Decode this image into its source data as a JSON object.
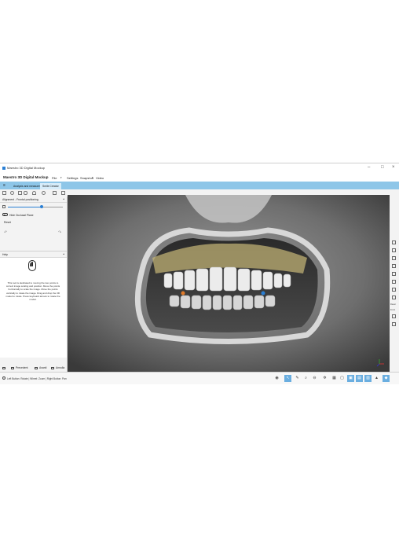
{
  "window": {
    "title": "Maestro 3D Digital Mockup",
    "controls": {
      "minimize": "–",
      "maximize": "□",
      "close": "×"
    }
  },
  "menubar": {
    "app_name": "Maestro 3D Digital Mockup",
    "items": [
      "File",
      "Settings",
      "Snapshot",
      "Video"
    ]
  },
  "tabs": [
    {
      "label": "Analysis and measures",
      "active": false
    },
    {
      "label": "Smile Creator",
      "active": true
    }
  ],
  "left_panel": {
    "section1_title": "Alignment - Frontal positioning",
    "toggle_label": "Hide Occlusal Plane",
    "reset_label": "Reset",
    "slider_value": 0.62,
    "section2_title": "Help",
    "help_text": "This tool is dedicated to moving the two points to correct image scaling and position. Move the points horizontally to scale the image. Move the points vertically to rotate the image. Drag and drop the 3D model to rotate. Press keyboard arrows to rotate the model.",
    "footer_buttons": [
      "Precedent",
      "Avanti",
      "Annulla"
    ]
  },
  "status_bar": {
    "hint": "Left Button: Rotate | Wheel: Zoom | Right Button: Pan"
  },
  "right_toolbar": {
    "label_reset": "Reset",
    "label_front": "Front"
  },
  "colors": {
    "accent": "#2a7fd4",
    "tab_bar": "#8ec6e8",
    "selected": "#6aaee0",
    "point_left": "#e07a2a",
    "point_right": "#2a7fd4",
    "overlay": "#c8b878"
  }
}
